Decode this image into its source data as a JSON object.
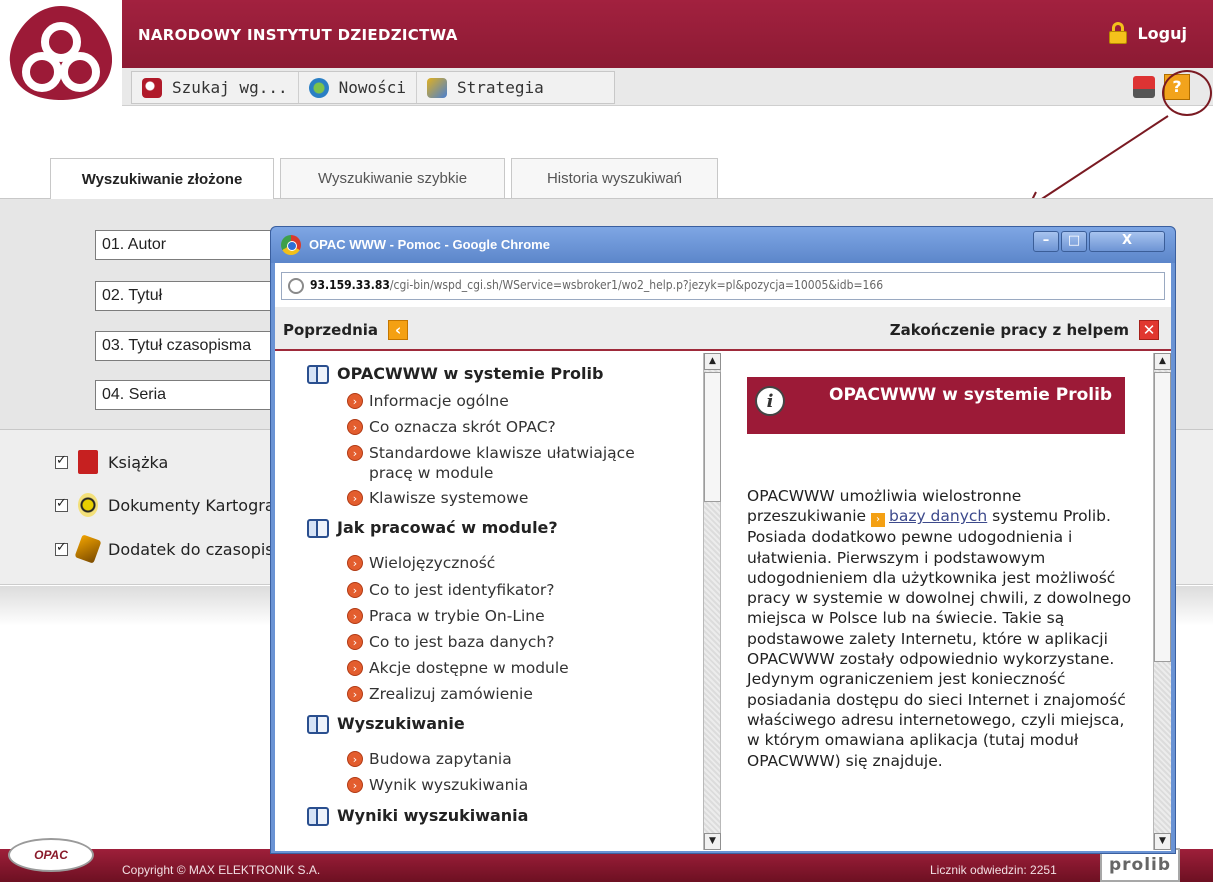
{
  "header": {
    "title": "NARODOWY INSTYTUT DZIEDZICTWA",
    "login_label": "Loguj"
  },
  "nav": {
    "items": [
      {
        "label": "Szukaj wg...",
        "icon": "search-icon"
      },
      {
        "label": "Nowości",
        "icon": "news-icon"
      },
      {
        "label": "Strategia",
        "icon": "strategy-icon"
      }
    ],
    "help_label": "?"
  },
  "tabs": [
    {
      "label": "Wyszukiwanie złożone",
      "active": true
    },
    {
      "label": "Wyszukiwanie szybkie",
      "active": false
    },
    {
      "label": "Historia wyszukiwań",
      "active": false
    }
  ],
  "search_fields": [
    "01. Autor",
    "02. Tytuł",
    "03. Tytuł czasopisma",
    "04. Seria"
  ],
  "document_types": [
    {
      "label": "Książka",
      "checked": true
    },
    {
      "label": "Dokumenty Kartograficzne",
      "checked": true
    },
    {
      "label": "Dodatek do czasopisma",
      "checked": true
    }
  ],
  "footer": {
    "copyright": "Copyright © MAX ELEKTRONIK S.A.",
    "counter": "Licznik odwiedzin: 2251",
    "opac_logo": "OPAC",
    "prolib_logo": "prolib"
  },
  "help_window": {
    "title": "OPAC WWW - Pomoc - Google Chrome",
    "url_host": "93.159.33.83",
    "url_path": "/cgi-bin/wspd_cgi.sh/WService=wsbroker1/wo2_help.p?jezyk=pl&pozycja=10005&idb=166",
    "prev_label": "Poprzednia",
    "end_label": "Zakończenie pracy z helpem",
    "toc": [
      {
        "title": "OPACWWW w systemie Prolib",
        "items": [
          "Informacje ogólne",
          "Co oznacza skrót OPAC?",
          "Standardowe klawisze ułatwiające pracę w module",
          "Klawisze systemowe"
        ]
      },
      {
        "title": "Jak pracować w module?",
        "items": [
          "Wielojęzyczność",
          "Co to jest identyfikator?",
          "Praca w trybie On-Line",
          "Co to jest baza danych?",
          "Akcje dostępne w module",
          "Zrealizuj zamówienie"
        ]
      },
      {
        "title": "Wyszukiwanie",
        "items": [
          "Budowa zapytania",
          "Wynik wyszukiwania"
        ]
      },
      {
        "title": "Wyniki wyszukiwania",
        "items": []
      }
    ],
    "content": {
      "heading": "OPACWWW w systemie Prolib",
      "text_before": "OPACWWW umożliwia wielostronne przeszukiwanie ",
      "link": "bazy danych",
      "text_after": " systemu Prolib. Posiada dodatkowo pewne udogodnienia i ułatwienia. Pierwszym i podstawowym udogodnieniem dla użytkownika jest możliwość pracy w systemie w dowolnej chwili, z dowolnego miejsca w Polsce lub na świecie. Takie są podstawowe zalety Internetu, które w aplikacji OPACWWW zostały odpowiednio wykorzystane. Jedynym ograniczeniem jest konieczność posiadania dostępu do sieci Internet i znajomość właściwego adresu internetowego, czyli miejsca, w którym omawiana aplikacja (tutaj moduł OPACWWW) się znajduje."
    }
  },
  "colors": {
    "brand": "#9c1a37",
    "accent": "#f4a013",
    "window_frame": "#6a93d4"
  }
}
